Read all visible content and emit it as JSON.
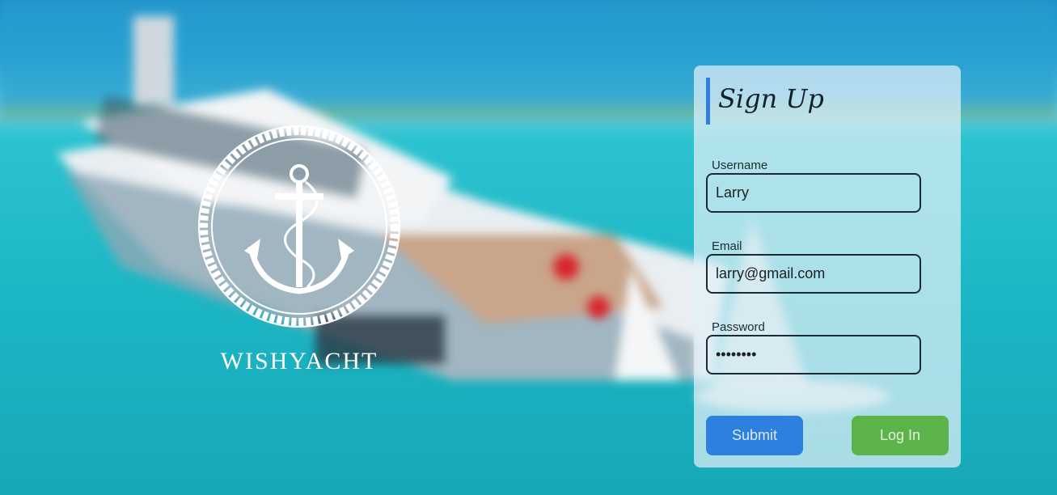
{
  "brand": {
    "name": "WISHYACHT"
  },
  "signup": {
    "title": "Sign Up",
    "username": {
      "label": "Username",
      "value": "Larry"
    },
    "email": {
      "label": "Email",
      "value": "larry@gmail.com"
    },
    "password": {
      "label": "Password",
      "value": "password"
    },
    "submit_label": "Submit",
    "login_label": "Log In"
  },
  "colors": {
    "accent": "#2f7fe0",
    "submit": "#2d7fe0",
    "login": "#5bb34a",
    "sea": "#1cb6c4"
  }
}
